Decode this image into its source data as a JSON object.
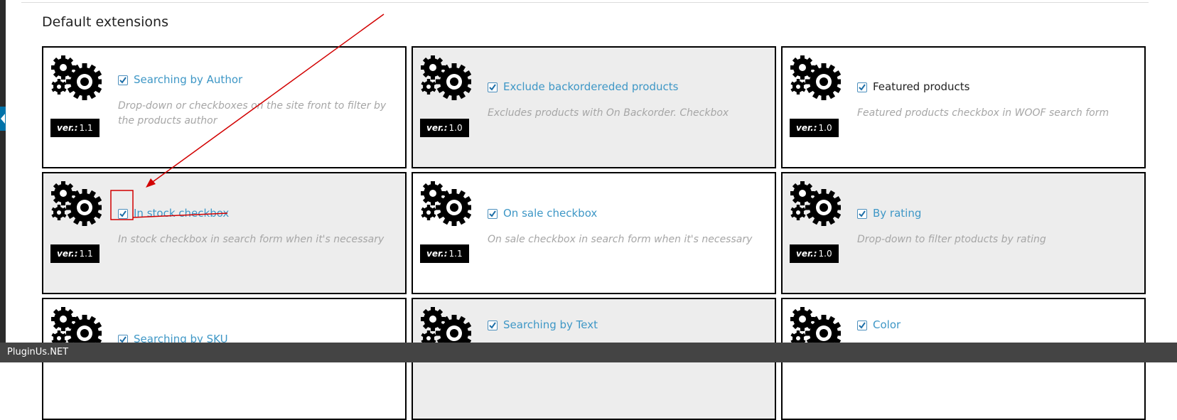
{
  "section": {
    "title": "Default extensions"
  },
  "cards": [
    {
      "title": "Searching by Author",
      "title_style": "link",
      "checked": true,
      "desc": "Drop-down or checkboxes on the site front to filter by the products author",
      "ver_label": "ver.:",
      "ver_value": "1.1",
      "bg": "white"
    },
    {
      "title": "Exclude backorderеded products",
      "title_style": "link",
      "checked": true,
      "desc": "Excludes products with On Backorder. Checkbox",
      "ver_label": "ver.:",
      "ver_value": "1.0",
      "bg": "gray"
    },
    {
      "title": "Featured products",
      "title_style": "plain",
      "checked": true,
      "desc": "Featured products checkbox in WOOF search form",
      "ver_label": "ver.:",
      "ver_value": "1.0",
      "bg": "white"
    },
    {
      "title": "In stock checkbox",
      "title_style": "link",
      "checked": true,
      "desc": "In stock checkbox in search form when it's necessary",
      "ver_label": "ver.:",
      "ver_value": "1.1",
      "bg": "gray"
    },
    {
      "title": "On sale checkbox",
      "title_style": "link",
      "checked": true,
      "desc": "On sale checkbox in search form when it's necessary",
      "ver_label": "ver.:",
      "ver_value": "1.1",
      "bg": "white"
    },
    {
      "title": "By rating",
      "title_style": "link",
      "checked": true,
      "desc": "Drop-down to filter ptoducts by rating",
      "ver_label": "ver.:",
      "ver_value": "1.0",
      "bg": "gray"
    },
    {
      "title": "Searching by SKU",
      "title_style": "link",
      "checked": true,
      "desc": "",
      "ver_label": "",
      "ver_value": "",
      "bg": "white"
    },
    {
      "title": "Searching by Text",
      "title_style": "link",
      "checked": true,
      "desc": "",
      "ver_label": "",
      "ver_value": "",
      "bg": "gray"
    },
    {
      "title": "Color",
      "title_style": "link",
      "checked": true,
      "desc": "",
      "ver_label": "",
      "ver_value": "",
      "bg": "white"
    }
  ],
  "footer": {
    "brand": "PluginUs.NET"
  },
  "colors": {
    "link": "#3e97c6",
    "annotation": "#d20000",
    "checkbox_border": "#4c8fbd"
  },
  "icons": {
    "card_icon": "gears-icon",
    "check": "checkmark-icon"
  }
}
